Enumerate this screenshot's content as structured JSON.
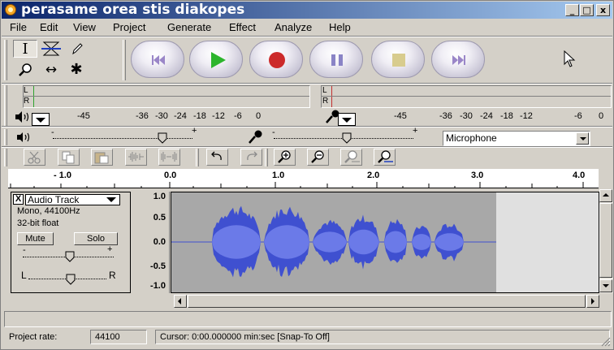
{
  "window": {
    "title": "perasame orea stis diakopes",
    "minimize_glyph": "_",
    "maximize_glyph": "□",
    "close_glyph": "x"
  },
  "menu": [
    "File",
    "Edit",
    "View",
    "Project",
    "Generate",
    "Effect",
    "Analyze",
    "Help"
  ],
  "tools": [
    {
      "name": "selection-tool",
      "glyph": "I"
    },
    {
      "name": "envelope-tool",
      "glyph": "envelope-icon"
    },
    {
      "name": "draw-tool",
      "glyph": "pencil-icon"
    },
    {
      "name": "zoom-tool",
      "glyph": "magnifier-icon"
    },
    {
      "name": "timeshift-tool",
      "glyph": "↔"
    },
    {
      "name": "multi-tool",
      "glyph": "✱"
    }
  ],
  "transport": [
    "skip-to-start",
    "play",
    "record",
    "pause",
    "stop",
    "skip-to-end"
  ],
  "meters": {
    "output_scale": [
      "-45",
      "-36",
      "-30",
      "-24",
      "-18",
      "-12",
      "-6",
      "0"
    ],
    "input_scale": [
      "-45",
      "-36",
      "-30",
      "-24",
      "-18",
      "-12",
      "-6",
      "0"
    ],
    "left_channel": "L",
    "right_channel": "R"
  },
  "mixer": {
    "input_source": "Microphone",
    "slider_minus": "-",
    "slider_plus": "+"
  },
  "ruler": {
    "labels": [
      "- 1.0",
      "0.0",
      "1.0",
      "2.0",
      "3.0",
      "4.0"
    ]
  },
  "track": {
    "name": "Audio Track",
    "format": "Mono, 44100Hz",
    "bit_depth": "32-bit float",
    "mute_label": "Mute",
    "solo_label": "Solo",
    "gain_minus": "-",
    "gain_plus": "+",
    "pan_left": "L",
    "pan_right": "R",
    "vruler": [
      "1.0",
      "0.5",
      "0.0",
      "-0.5",
      "-1.0"
    ],
    "close_glyph": "X"
  },
  "status": {
    "rate_label": "Project rate:",
    "rate_value": "44100",
    "cursor_text": "Cursor: 0:00.000000 min:sec  [Snap-To Off]"
  },
  "colors": {
    "waveform": "#3f50d0",
    "waveform_light": "#6b7ae8",
    "titlebar_start": "#0a246a",
    "play_green": "#2db52d",
    "record_red": "#cc2a2a"
  }
}
